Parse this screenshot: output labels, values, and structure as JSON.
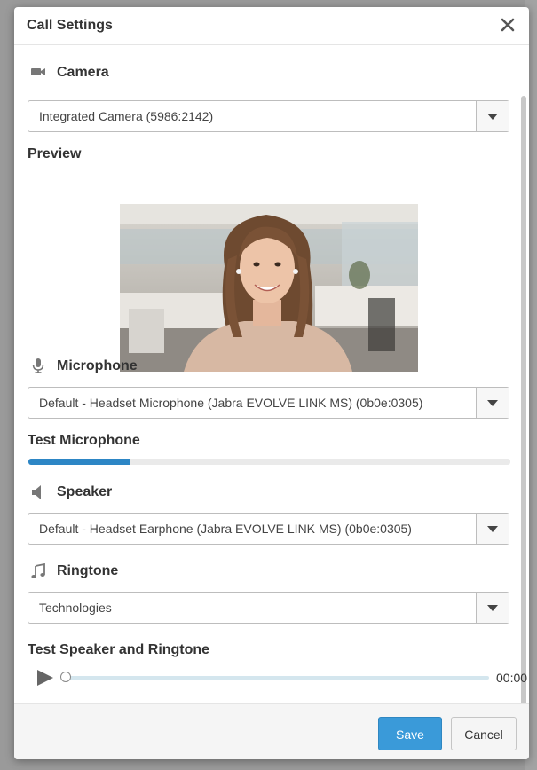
{
  "dialog": {
    "title": "Call Settings",
    "close_icon": "close-icon"
  },
  "camera": {
    "label": "Camera",
    "icon": "camera-icon",
    "selected": "Integrated Camera (5986:2142)"
  },
  "preview": {
    "label": "Preview",
    "image": "webcam preview of smiling woman in office"
  },
  "microphone": {
    "label": "Microphone",
    "icon": "microphone-icon",
    "selected": "Default - Headset Microphone (Jabra EVOLVE LINK MS) (0b0e:0305)"
  },
  "test_microphone": {
    "label": "Test Microphone",
    "level": 0.21
  },
  "speaker": {
    "label": "Speaker",
    "icon": "speaker-icon",
    "selected": "Default - Headset Earphone (Jabra EVOLVE LINK MS) (0b0e:0305)"
  },
  "ringtone": {
    "label": "Ringtone",
    "icon": "music-note-icon",
    "selected": "Technologies"
  },
  "test_speaker": {
    "label": "Test Speaker and Ringtone",
    "time": "00:00",
    "progress": 0
  },
  "footer": {
    "save_label": "Save",
    "cancel_label": "Cancel"
  },
  "colors": {
    "accent": "#3a9ad9",
    "meter": "#2d86c5",
    "overlay": "#8f8f8f"
  }
}
